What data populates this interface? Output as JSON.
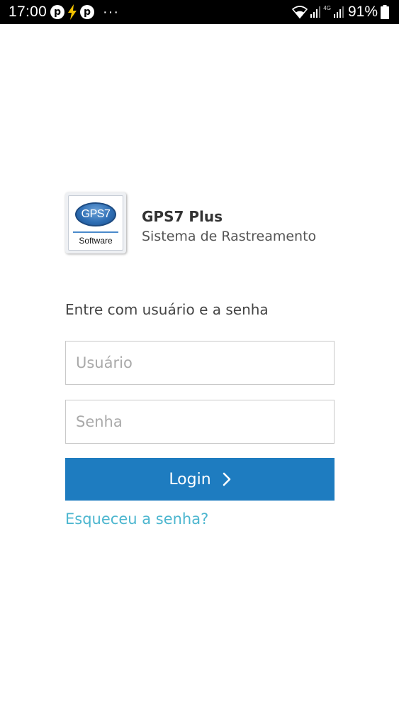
{
  "status_bar": {
    "time": "17:00",
    "network": "4G",
    "battery": "91%",
    "icons": [
      "pinterest-icon",
      "flash-icon",
      "pinterest-icon",
      "more-dots-icon",
      "wifi-icon",
      "signal-icon",
      "signal-icon",
      "battery-icon"
    ]
  },
  "header": {
    "logo_text_top": "GPS7",
    "logo_text_bottom": "Software",
    "title": "GPS7 Plus",
    "subtitle": "Sistema de Rastreamento"
  },
  "form": {
    "prompt": "Entre com usuário e a senha",
    "username": {
      "value": "",
      "placeholder": "Usuário"
    },
    "password": {
      "value": "",
      "placeholder": "Senha"
    },
    "login_label": "Login",
    "forgot_label": "Esqueceu a senha?"
  },
  "colors": {
    "status_bar": "#000000",
    "primary_button": "#1e7cc0",
    "link": "#4cb6cf",
    "title_text": "#333333",
    "subtitle_text": "#555555",
    "field_border": "#c9c9c9",
    "placeholder": "#a9a9a9"
  }
}
